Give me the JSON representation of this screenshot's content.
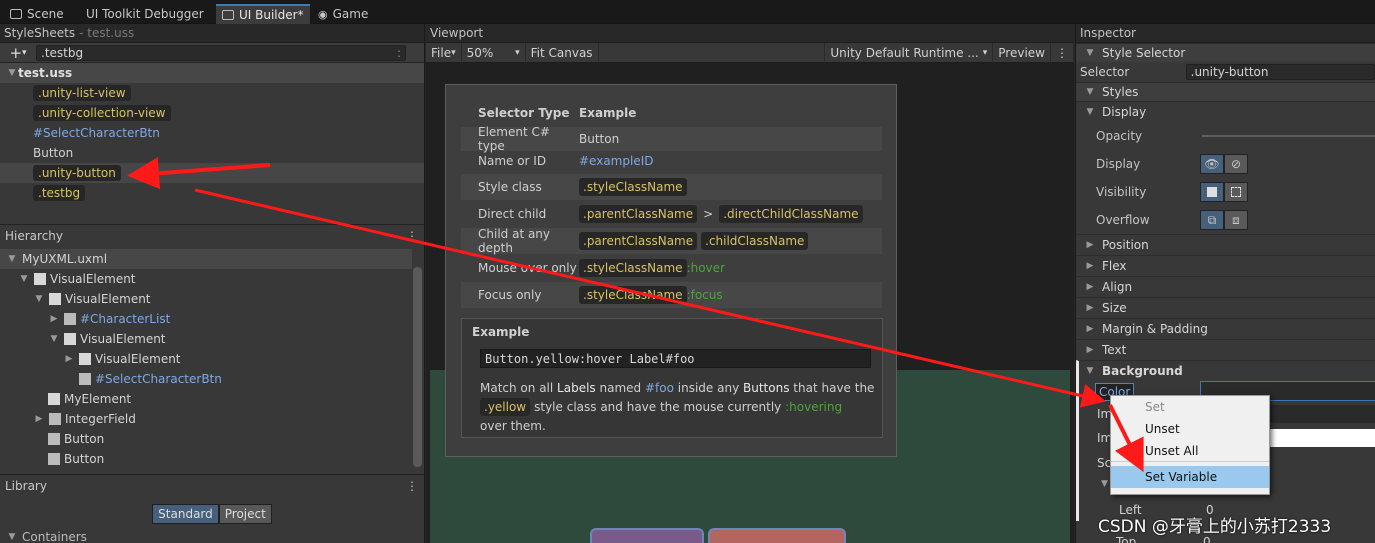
{
  "tabs": [
    {
      "label": "Scene",
      "icon": "scene-icon"
    },
    {
      "label": "UI Toolkit Debugger",
      "icon": "debugger-icon"
    },
    {
      "label": "UI Builder*",
      "icon": "uibuilder-icon"
    },
    {
      "label": "Game",
      "icon": "gamepad-icon"
    }
  ],
  "stylesheets": {
    "title": "StyleSheets",
    "subtitle": "- test.uss",
    "selector_input": ".testbg",
    "sheet": "test.uss",
    "items": [
      ".unity-list-view",
      ".unity-collection-view",
      "#SelectCharacterBtn",
      "Button",
      ".unity-button",
      ".testbg"
    ]
  },
  "hierarchy": {
    "title": "Hierarchy",
    "file": "MyUXML.uxml",
    "items": [
      "VisualElement",
      "VisualElement",
      "#CharacterList",
      "VisualElement",
      "VisualElement",
      "#SelectCharacterBtn",
      "MyElement",
      "IntegerField",
      "Button",
      "Button"
    ]
  },
  "library": {
    "title": "Library",
    "tab_standard": "Standard",
    "tab_project": "Project",
    "containers": "Containers"
  },
  "viewport": {
    "title": "Viewport",
    "file": "File",
    "zoom": "50%",
    "fit": "Fit Canvas",
    "theme": "Unity Default Runtime ...",
    "preview": "Preview"
  },
  "selector_help": {
    "col1": "Selector Type",
    "col2": "Example",
    "rows": [
      {
        "type": "Element C# type",
        "ex": "Button"
      },
      {
        "type": "Name or ID",
        "ex": "#exampleID"
      },
      {
        "type": "Style class",
        "ex": ".styleClassName"
      },
      {
        "type": "Direct child",
        "ex1": ".parentClassName",
        "sep": ">",
        "ex2": ".directChildClassName"
      },
      {
        "type": "Child at any depth",
        "ex1": ".parentClassName",
        "ex2": ".childClassName"
      },
      {
        "type": "Mouse over only",
        "ex1": ".styleClassName",
        "ex2": ":hover"
      },
      {
        "type": "Focus only",
        "ex1": ".styleClassName",
        "ex2": ":focus"
      }
    ],
    "example_title": "Example",
    "example_code": "Button.yellow:hover Label#foo",
    "desc1": "Match on all",
    "desc_labels": "Labels",
    "desc2": "named",
    "desc_foo": "#foo",
    "desc3": "inside any",
    "desc_buttons": "Buttons",
    "desc4": "that have the",
    "desc_yellow": ".yellow",
    "desc5": "style class and have the mouse currently",
    "desc_hovering": ":hovering",
    "desc6": "over them."
  },
  "inspector": {
    "title": "Inspector",
    "style_selector": "Style Selector",
    "selector_label": "Selector",
    "selector_value": ".unity-button",
    "styles": "Styles",
    "display": "Display",
    "opacity": "Opacity",
    "display_prop": "Display",
    "visibility": "Visibility",
    "overflow": "Overflow",
    "sections": [
      "Position",
      "Flex",
      "Align",
      "Size",
      "Margin & Padding",
      "Text"
    ],
    "background": "Background",
    "color": "Color",
    "im1": "Im",
    "im2": "Im",
    "sc": "Sc",
    "left": "Left",
    "top": "Top",
    "zero1": "0",
    "zero2": "0"
  },
  "context_menu": {
    "items": [
      "Set",
      "Unset",
      "Unset All",
      "Set Variable"
    ]
  },
  "watermark": "CSDN @牙膏上的小苏打2333"
}
